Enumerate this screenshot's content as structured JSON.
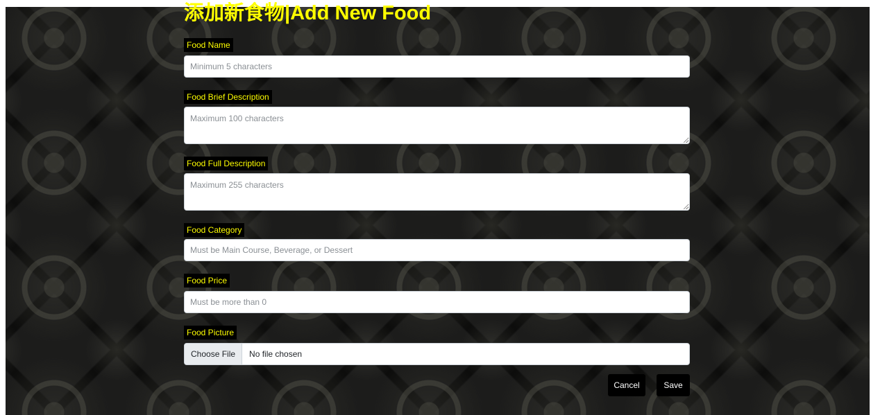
{
  "page": {
    "title": "添加新食物|Add New Food",
    "accent_color": "#ffff00",
    "label_background": "#000000"
  },
  "form": {
    "food_name": {
      "label": "Food Name",
      "placeholder": "Minimum 5 characters",
      "value": ""
    },
    "brief_description": {
      "label": "Food Brief Description",
      "placeholder": "Maximum 100 characters",
      "value": ""
    },
    "full_description": {
      "label": "Food Full Description",
      "placeholder": "Maximum 255 characters",
      "value": ""
    },
    "category": {
      "label": "Food Category",
      "placeholder": "Must be Main Course, Beverage, or Dessert",
      "value": ""
    },
    "price": {
      "label": "Food Price",
      "placeholder": "Must be more than 0",
      "value": ""
    },
    "picture": {
      "label": "Food Picture",
      "button_label": "Choose File",
      "status_text": "No file chosen"
    }
  },
  "actions": {
    "cancel_label": "Cancel",
    "save_label": "Save"
  }
}
